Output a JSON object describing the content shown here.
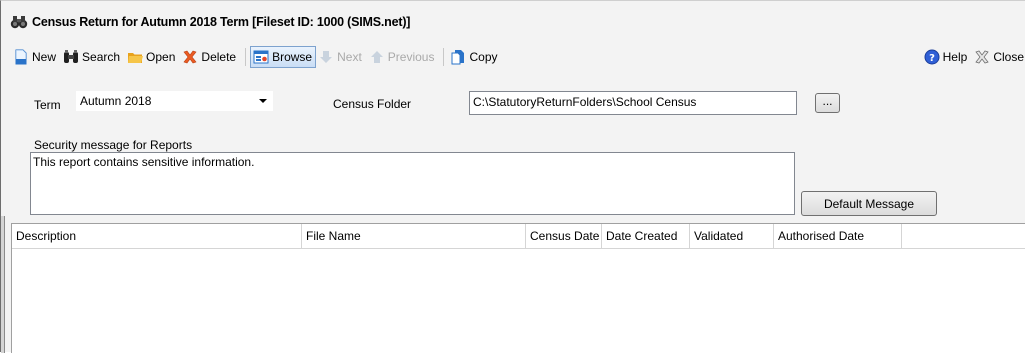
{
  "window": {
    "title": "Census Return for Autumn 2018 Term [Fileset ID: 1000 (SIMS.net)]",
    "icon": "binoculars-icon"
  },
  "toolbar": {
    "items": [
      {
        "label": "New",
        "icon": "new-document-icon",
        "enabled": true
      },
      {
        "label": "Search",
        "icon": "binoculars-icon",
        "enabled": true
      },
      {
        "label": "Open",
        "icon": "folder-icon",
        "enabled": true
      },
      {
        "label": "Delete",
        "icon": "delete-x-icon",
        "enabled": true
      },
      {
        "label": "Browse",
        "icon": "browse-icon",
        "enabled": true,
        "active": true
      },
      {
        "label": "Next",
        "icon": "arrow-down-icon",
        "enabled": false
      },
      {
        "label": "Previous",
        "icon": "arrow-up-icon",
        "enabled": false
      },
      {
        "label": "Copy",
        "icon": "copy-icon",
        "enabled": true
      }
    ],
    "right_items": [
      {
        "label": "Help",
        "icon": "help-icon"
      },
      {
        "label": "Close",
        "icon": "close-icon"
      }
    ]
  },
  "form": {
    "term_label": "Term",
    "term_value": "Autumn 2018",
    "census_folder_label": "Census Folder",
    "census_folder_value": "C:\\StatutoryReturnFolders\\School Census",
    "browse_button_label": "...",
    "security_label": "Security message for Reports",
    "security_message": "This report contains sensitive information.",
    "default_message_button": "Default Message"
  },
  "table": {
    "columns": [
      "Description",
      "File Name",
      "Census Date",
      "Date Created",
      "Validated",
      "Authorised Date"
    ],
    "rows": []
  },
  "colors": {
    "accent": "#1e6fd0",
    "delete": "#e05a1f",
    "folder": "#f2b632",
    "disabled_text": "#a9a9a9"
  }
}
